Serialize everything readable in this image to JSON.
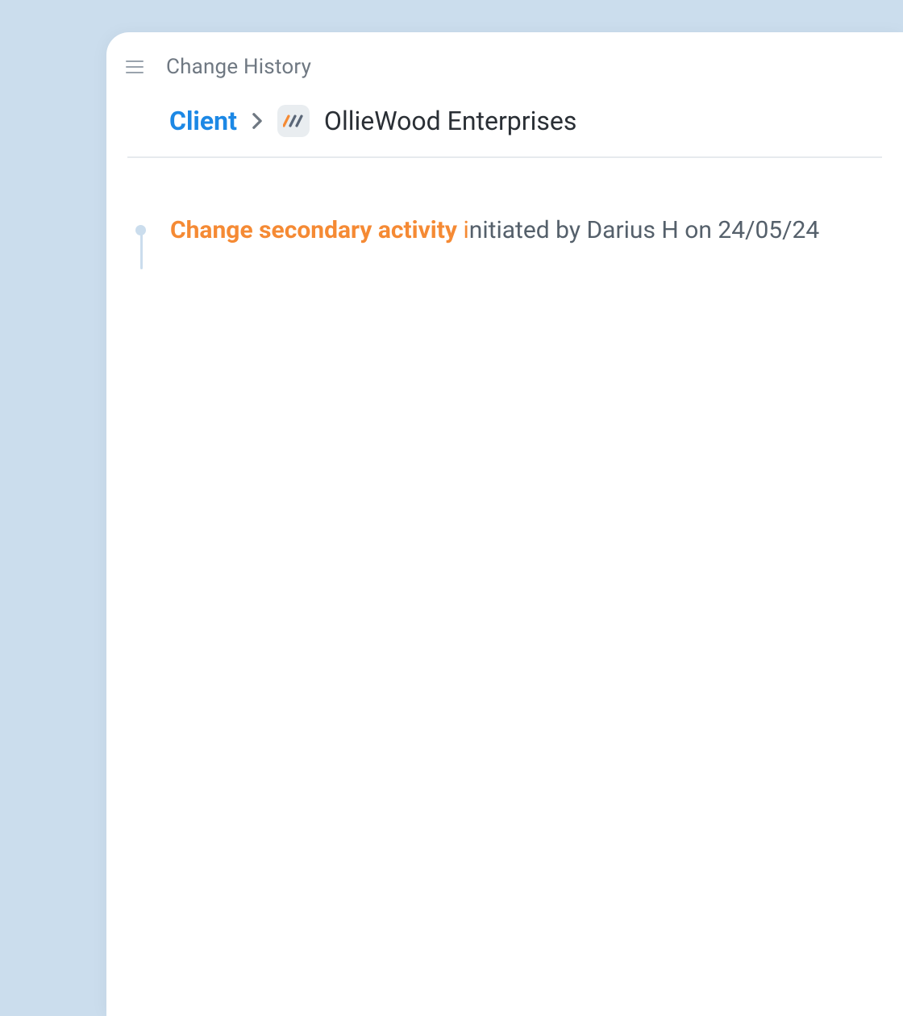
{
  "header": {
    "title": "Change History"
  },
  "breadcrumb": {
    "root_label": "Client",
    "client_name": "OllieWood Enterprises"
  },
  "timeline": {
    "items": [
      {
        "action": "Change secondary activity",
        "accent_char": "i",
        "meta_rest": "nitiated by Darius H on 24/05/24"
      }
    ]
  },
  "colors": {
    "background": "#cbdded",
    "accent_blue": "#1c88e5",
    "accent_orange": "#f58a34"
  }
}
